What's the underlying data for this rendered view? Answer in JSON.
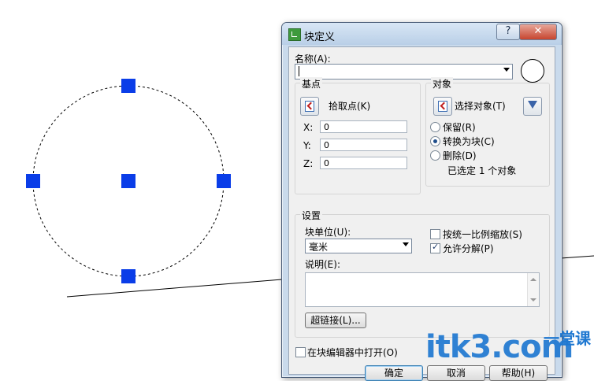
{
  "dialog": {
    "title": "块定义",
    "help_glyph": "?",
    "close_glyph": "✕"
  },
  "name": {
    "label": "名称(A):",
    "value": ""
  },
  "base_point": {
    "group_title": "基点",
    "pick_label": "拾取点(K)",
    "x_label": "X:",
    "x_value": "0",
    "y_label": "Y:",
    "y_value": "0",
    "z_label": "Z:",
    "z_value": "0"
  },
  "objects": {
    "group_title": "对象",
    "select_label": "选择对象(T)",
    "retain_label": "保留(R)",
    "convert_label": "转换为块(C)",
    "delete_label": "删除(D)",
    "selected_status": "已选定 1 个对象",
    "selected_option": "convert"
  },
  "settings": {
    "group_title": "设置",
    "unit_label": "块单位(U):",
    "unit_value": "毫米",
    "scale_uniform_label": "按统一比例缩放(S)",
    "scale_uniform_checked": false,
    "allow_explode_label": "允许分解(P)",
    "allow_explode_checked": true,
    "description_label": "说明(E):",
    "description_value": "",
    "hyperlink_button": "超链接(L)..."
  },
  "open_in_editor_label": "在块编辑器中打开(O)",
  "open_in_editor_checked": false,
  "buttons": {
    "ok": "确定",
    "cancel": "取消",
    "help": "帮助(H)"
  },
  "watermark": {
    "domain_text": "itk3.com",
    "cn_text": "一堂课"
  },
  "colors": {
    "grip": "#0a3de8",
    "dialog_frame": "#c9daec",
    "watermark": "#1f78d1"
  }
}
